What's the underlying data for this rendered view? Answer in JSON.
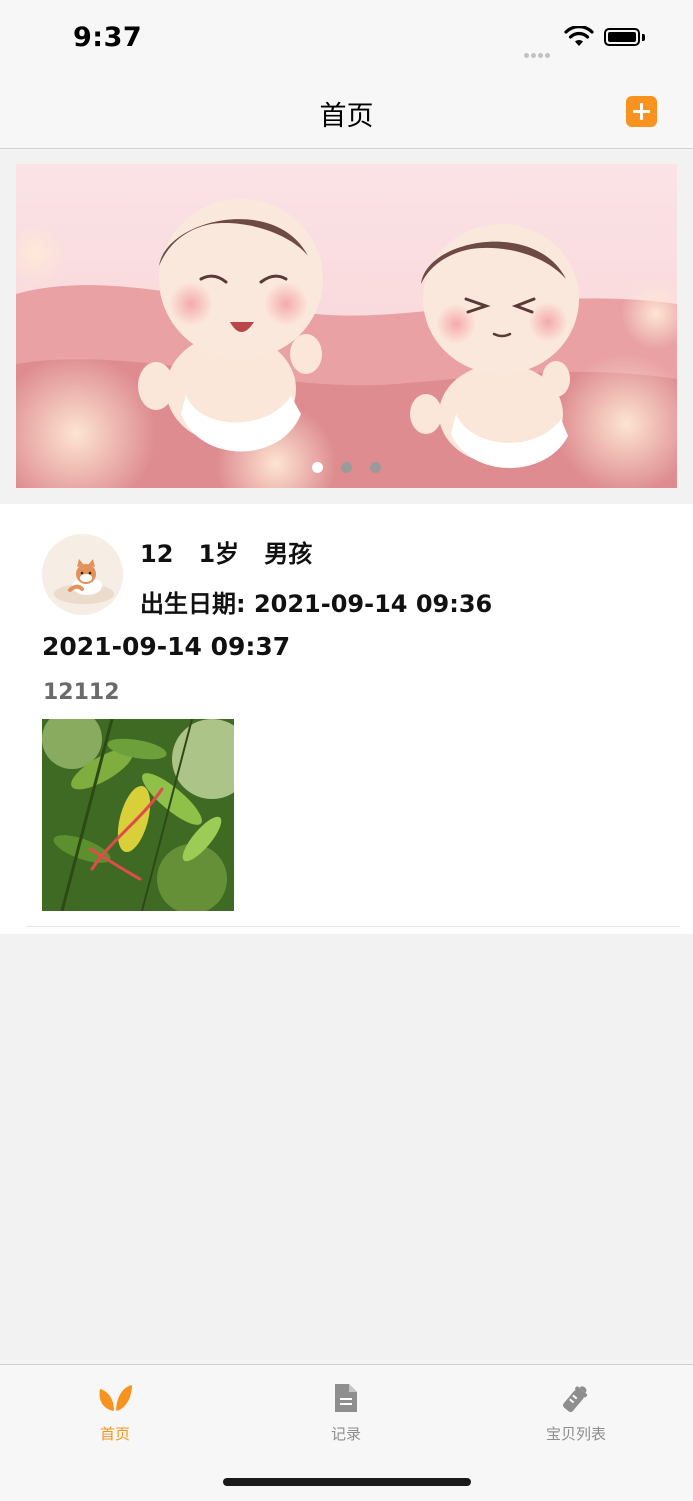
{
  "status_bar": {
    "time": "9:37"
  },
  "nav": {
    "title": "首页",
    "add_icon": "plus-square-icon"
  },
  "banner": {
    "page_count": 3,
    "active_page": 0,
    "dot_active_color": "#ffffff",
    "dot_inactive_color": "#9a9a9a"
  },
  "baby": {
    "summary": "12   1岁   男孩",
    "birth": "出生日期: 2021-09-14 09:36"
  },
  "record": {
    "date": "2021-09-14 09:37",
    "text": "12112"
  },
  "tabs": [
    {
      "label": "首页",
      "icon": "leaf-icon",
      "selected": true
    },
    {
      "label": "记录",
      "icon": "document-icon",
      "selected": false
    },
    {
      "label": "宝贝列表",
      "icon": "baby-bottle-icon",
      "selected": false
    }
  ],
  "colors": {
    "accent": "#f7931e",
    "tab_inactive": "#8e8e8e",
    "background": "#f2f2f2"
  }
}
